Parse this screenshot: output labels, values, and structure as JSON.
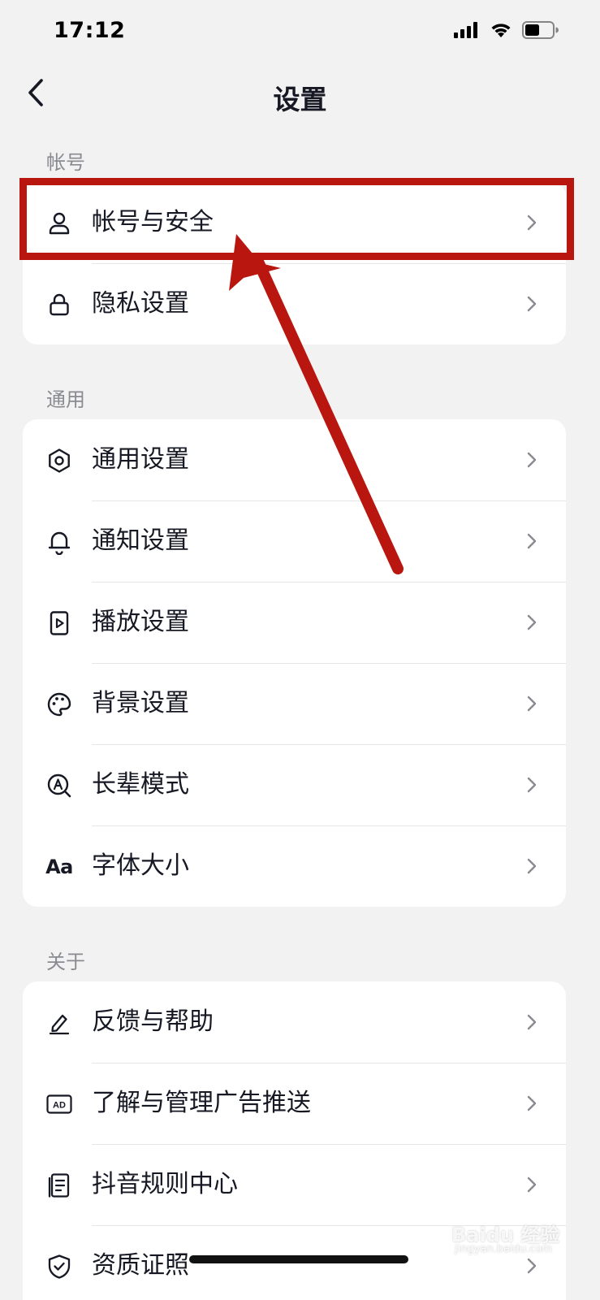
{
  "status_bar": {
    "time": "17:12",
    "icons": [
      "signal-icon",
      "wifi-icon",
      "battery-icon"
    ]
  },
  "nav": {
    "title": "设置",
    "back_icon": "chevron-left-icon"
  },
  "sections": {
    "account": {
      "label": "帐号",
      "items": [
        {
          "label": "帐号与安全",
          "icon": "user-icon"
        },
        {
          "label": "隐私设置",
          "icon": "lock-icon"
        }
      ]
    },
    "general": {
      "label": "通用",
      "items": [
        {
          "label": "通用设置",
          "icon": "gear-icon"
        },
        {
          "label": "通知设置",
          "icon": "bell-icon"
        },
        {
          "label": "播放设置",
          "icon": "play-icon"
        },
        {
          "label": "背景设置",
          "icon": "palette-icon"
        },
        {
          "label": "长辈模式",
          "icon": "elder-mode-icon"
        },
        {
          "label": "字体大小",
          "icon": "font-size-icon",
          "icon_text": "Aa"
        }
      ]
    },
    "about": {
      "label": "关于",
      "items": [
        {
          "label": "反馈与帮助",
          "icon": "edit-icon"
        },
        {
          "label": "了解与管理广告推送",
          "icon": "ad-icon",
          "icon_text": "AD"
        },
        {
          "label": "抖音规则中心",
          "icon": "rules-icon"
        },
        {
          "label": "资质证照",
          "icon": "shield-check-icon"
        }
      ]
    }
  },
  "annotation": {
    "highlight_color": "#b8160f",
    "target": "帐号与安全"
  },
  "watermark": {
    "text": "Baidu 经验",
    "sub": "jingyan.baidu.com"
  },
  "colors": {
    "background": "#f2f2f2",
    "card": "#ffffff",
    "text": "#161823",
    "secondary_text": "#8a8b91"
  }
}
